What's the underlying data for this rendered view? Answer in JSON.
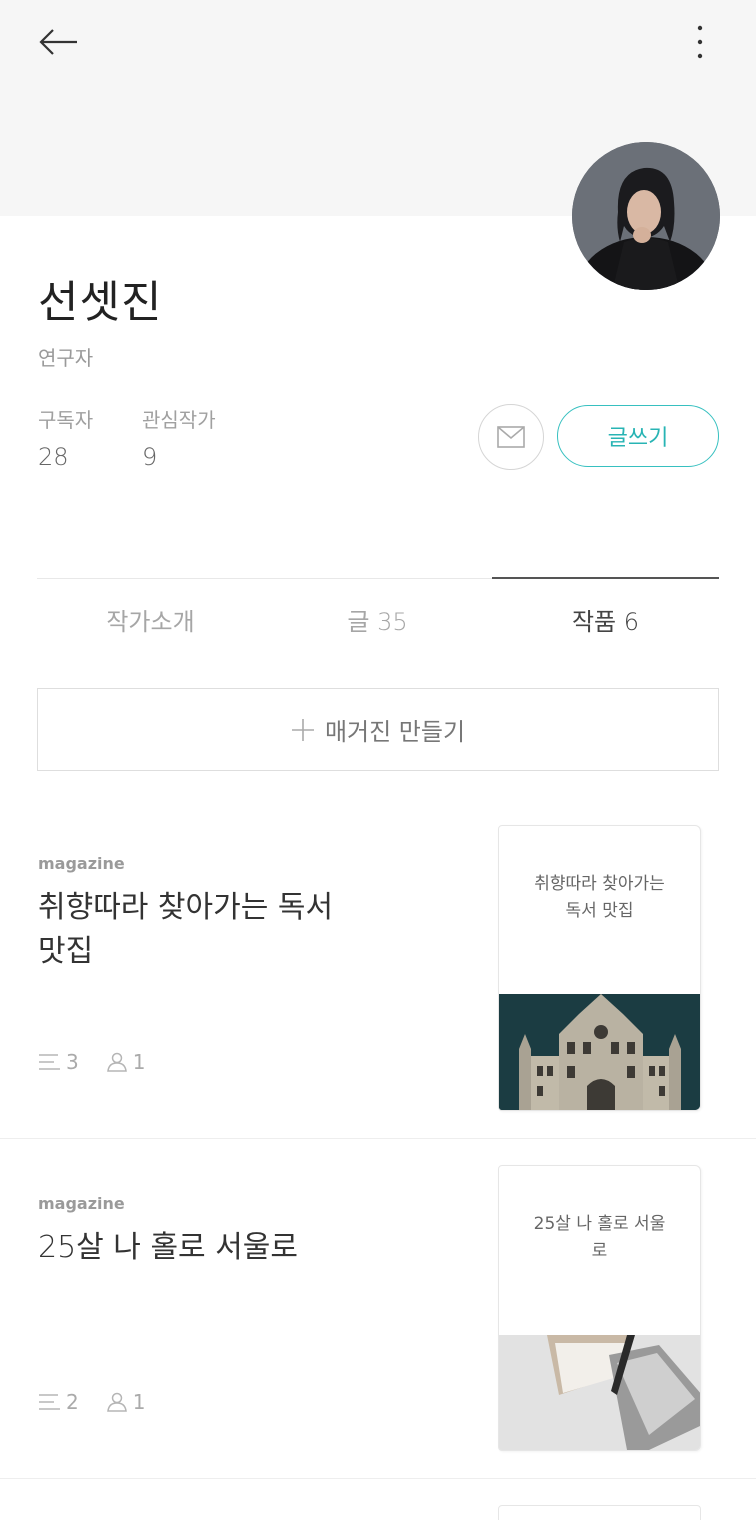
{
  "profile": {
    "name": "선셋진",
    "role": "연구자",
    "subscribers_label": "구독자",
    "subscribers_count": "28",
    "favorite_label": "관심작가",
    "favorite_count": "9",
    "write_label": "글쓰기"
  },
  "tabs": [
    {
      "label": "작가소개",
      "active": false
    },
    {
      "label": "글 35",
      "active": false
    },
    {
      "label": "작품 6",
      "active": true
    }
  ],
  "make_magazine_label": "매거진 만들기",
  "magazines": [
    {
      "kind": "magazine",
      "title": "취향따라 찾아가는 독서 맛집",
      "cover_title": "취향따라 찾아가는 독서 맛집",
      "post_count": "3",
      "writer_count": "1"
    },
    {
      "kind": "magazine",
      "title": "25살 나 홀로 서울로",
      "cover_title": "25살 나 홀로 서울로",
      "post_count": "2",
      "writer_count": "1"
    }
  ],
  "colors": {
    "accent": "#28b4b4",
    "header_bg": "#f6f6f6"
  },
  "icons": [
    "back-arrow-icon",
    "more-vertical-icon",
    "mail-icon",
    "plus-icon",
    "list-icon",
    "person-icon"
  ]
}
